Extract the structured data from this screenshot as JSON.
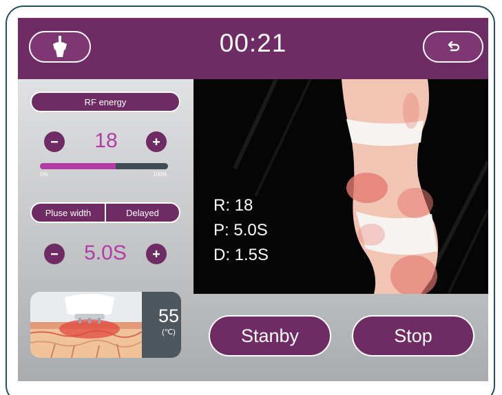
{
  "topbar": {
    "timer": "00:21",
    "home_icon": "handpiece-icon",
    "back_icon": "return-arrow-icon"
  },
  "rf_energy": {
    "label": "RF energy",
    "value": "18",
    "level_percent": 59,
    "min_label": "0%",
    "max_label": "100%"
  },
  "pulse": {
    "tab_pulse_width": "Pluse width",
    "tab_delayed": "Delayed",
    "value": "5.0S"
  },
  "readout": {
    "r": "R: 18",
    "p": "P: 5.0S",
    "d": "D: 1.5S"
  },
  "temperature": {
    "value": "55",
    "unit": "(℃)"
  },
  "actions": {
    "standby": "Stanby",
    "stop": "Stop"
  },
  "colors": {
    "brand_purple": "#6f2b64",
    "value_magenta": "#b23ba5",
    "frame": "#1f4f5f"
  }
}
